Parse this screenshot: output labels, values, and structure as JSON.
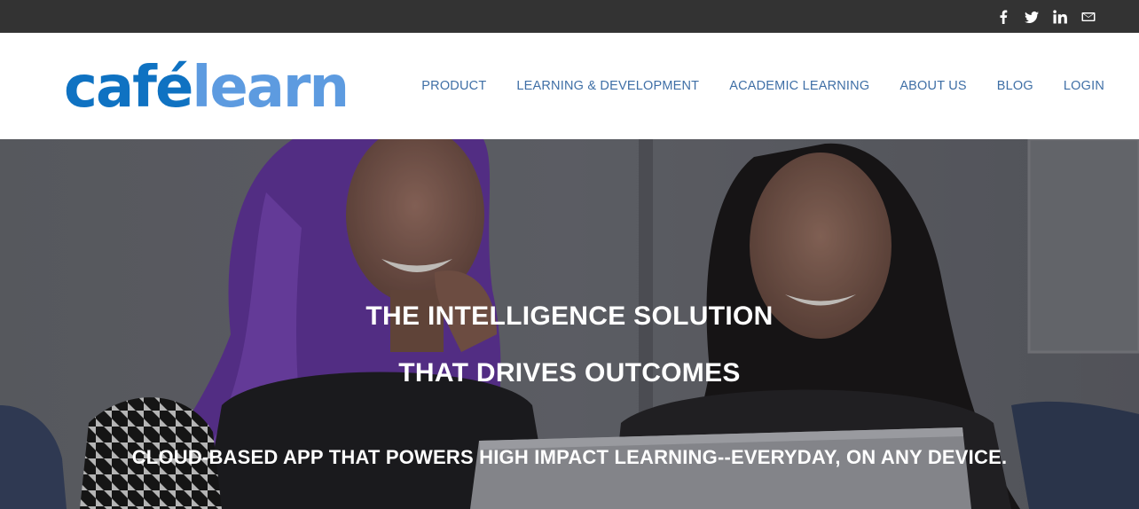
{
  "brand": {
    "part1": "café",
    "part2": "learn"
  },
  "social": [
    {
      "icon": "facebook-icon"
    },
    {
      "icon": "twitter-icon"
    },
    {
      "icon": "linkedin-icon"
    },
    {
      "icon": "mail-icon"
    }
  ],
  "nav": {
    "product": "PRODUCT",
    "learning_development": "LEARNING & DEVELOPMENT",
    "academic_learning": "ACADEMIC LEARNING",
    "about_us": "ABOUT US",
    "blog": "BLOG",
    "login": "LOGIN"
  },
  "hero": {
    "headline_line1": "THE INTELLIGENCE SOLUTION",
    "headline_line2": "THAT DRIVES OUTCOMES",
    "subheadline": "CLOUD-BASED APP THAT POWERS HIGH IMPACT LEARNING--EVERYDAY, ON ANY DEVICE."
  },
  "colors": {
    "topbar": "#333333",
    "logo_primary": "#0f72c2",
    "logo_secondary": "#5d9be0",
    "nav_link": "#3f6fa6"
  }
}
